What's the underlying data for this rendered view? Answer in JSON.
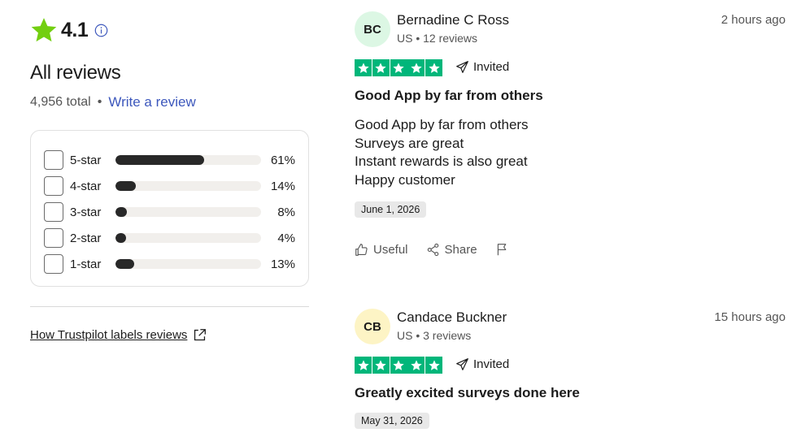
{
  "summary": {
    "rating": "4.1",
    "heading": "All reviews",
    "total": "4,956 total",
    "separator": "•",
    "write_review": "Write a review",
    "distribution": [
      {
        "label": "5-star",
        "percent_text": "61%",
        "fraction": 0.61
      },
      {
        "label": "4-star",
        "percent_text": "14%",
        "fraction": 0.14
      },
      {
        "label": "3-star",
        "percent_text": "8%",
        "fraction": 0.08
      },
      {
        "label": "2-star",
        "percent_text": "4%",
        "fraction": 0.04
      },
      {
        "label": "1-star",
        "percent_text": "13%",
        "fraction": 0.13
      }
    ],
    "labels_link": "How Trustpilot labels reviews"
  },
  "colors": {
    "trustpilot_green": "#00b67a",
    "summary_star": "#73cf11",
    "link_blue": "#3c57bc",
    "bar_fill": "#282828"
  },
  "reviews": [
    {
      "initials": "BC",
      "avatar_color": "#dcf7e4",
      "name": "Bernadine C Ross",
      "meta": "US • 12 reviews",
      "time": "2 hours ago",
      "stars": 5,
      "invited": "Invited",
      "title": "Good App by far from others",
      "body": [
        "Good App by far from others",
        "Surveys are great",
        "Instant rewards is also great",
        "Happy customer"
      ],
      "date": "June 1, 2026",
      "actions": {
        "useful": "Useful",
        "share": "Share"
      }
    },
    {
      "initials": "CB",
      "avatar_color": "#fdf4c5",
      "name": "Candace Buckner",
      "meta": "US • 3 reviews",
      "time": "15 hours ago",
      "stars": 5,
      "invited": "Invited",
      "title": "Greatly excited surveys done here",
      "date": "May 31, 2026"
    }
  ]
}
